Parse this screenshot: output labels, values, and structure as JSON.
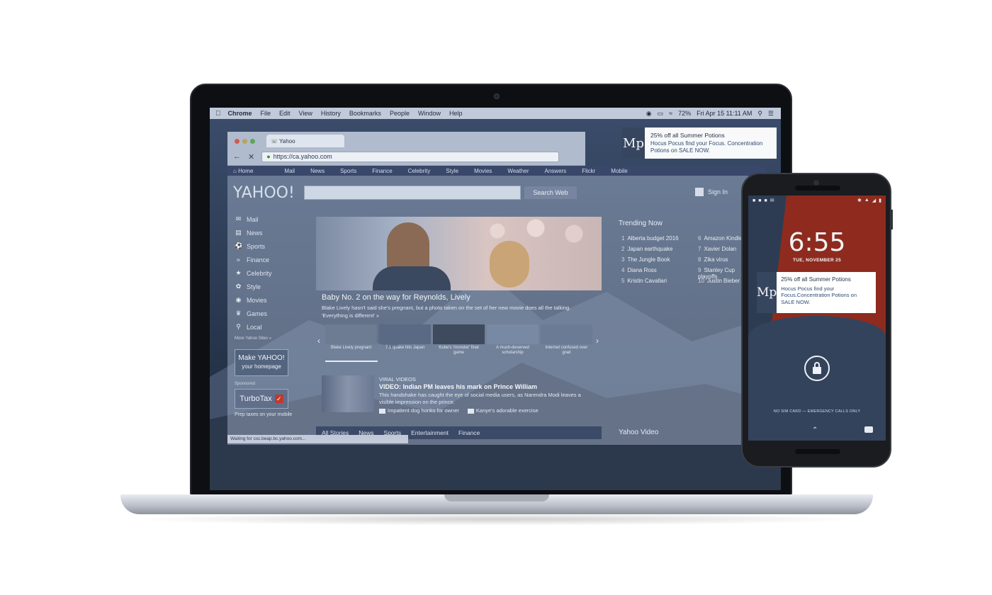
{
  "menubar": {
    "items": [
      "Chrome",
      "File",
      "Edit",
      "View",
      "History",
      "Bookmarks",
      "People",
      "Window",
      "Help"
    ],
    "battery": "72%",
    "datetime": "Fri Apr 15  11:11 AM"
  },
  "browser": {
    "tab_title": "Yahoo",
    "url": "https://ca.yahoo.com",
    "status": "Waiting for csc.beap.bc.yahoo.com..."
  },
  "yahoo": {
    "nav": [
      "Home",
      "Mail",
      "News",
      "Sports",
      "Finance",
      "Celebrity",
      "Style",
      "Movies",
      "Weather",
      "Answers",
      "Flickr",
      "Mobile"
    ],
    "logo": "YAHOO!",
    "search_button": "Search Web",
    "signin": "Sign In",
    "sidebar": [
      {
        "label": "Mail",
        "icon": "mail-icon"
      },
      {
        "label": "News",
        "icon": "news-icon"
      },
      {
        "label": "Sports",
        "icon": "sports-icon"
      },
      {
        "label": "Finance",
        "icon": "finance-icon"
      },
      {
        "label": "Celebrity",
        "icon": "star-icon"
      },
      {
        "label": "Style",
        "icon": "style-icon"
      },
      {
        "label": "Movies",
        "icon": "movies-icon"
      },
      {
        "label": "Games",
        "icon": "games-icon"
      },
      {
        "label": "Local",
        "icon": "pin-icon"
      }
    ],
    "more_sites": "More Yahoo Sites »",
    "make_home_line1": "Make YAHOO!",
    "make_home_line2": "your homepage",
    "sponsored": "Sponsored",
    "turbotax": "TurboTax",
    "prep_taxes": "Prep taxes on your mobile",
    "hero_title": "Baby No. 2 on the way for Reynolds, Lively",
    "hero_desc": "Blake Lively hasn't said she's pregnant, but a photo taken on the set of her new movie does all the talking. 'Everything is different' »",
    "thumbs": [
      "Blake Lively pregnant",
      "7.1 quake hits Japan",
      "Kobe's 'monster' final game",
      "A much-deserved scholarship",
      "Internet confused over grad"
    ],
    "viral_label": "VIRAL VIDEOS",
    "viral_title": "VIDEO: Indian PM leaves his mark on Prince William",
    "viral_desc": "This handshake has caught the eye of social media users, as Narendra Modi leaves a visible impression on the prince.",
    "viral_links": [
      "Impatient dog honks for owner",
      "Kanye's adorable exercise"
    ],
    "bottom_tabs": [
      "All Stories",
      "News",
      "Sports",
      "Entertainment",
      "Finance"
    ],
    "trending_title": "Trending Now",
    "trending_left": [
      {
        "num": "1",
        "label": "Alberta budget 2016"
      },
      {
        "num": "2",
        "label": "Japan earthquake"
      },
      {
        "num": "3",
        "label": "The Jungle Book"
      },
      {
        "num": "4",
        "label": "Diana Ross"
      },
      {
        "num": "5",
        "label": "Kristin Cavallari"
      }
    ],
    "trending_right": [
      {
        "num": "6",
        "label": "Amazon Kindle"
      },
      {
        "num": "7",
        "label": "Xavier Dolan"
      },
      {
        "num": "8",
        "label": "Zika virus"
      },
      {
        "num": "9",
        "label": "Stanley Cup playoffs"
      },
      {
        "num": "10",
        "label": "Justin Bieber"
      }
    ],
    "yahoo_video": "Yahoo Video"
  },
  "notification": {
    "logo": "Mp",
    "title": "25% off all Summer Potions",
    "body": "Hocus Pocus find your Focus. Concentration Potions on SALE NOW."
  },
  "phone": {
    "time": "6:55",
    "date": "TUE, NOVEMBER 25",
    "notif_logo": "Mp",
    "notif_title": "25% off all Summer Potions",
    "notif_body": "Hocus Pocus find your Focus.Concentration Potions on SALE NOW.",
    "sim": "NO SIM CARD — EMERGENCY CALLS ONLY"
  },
  "colors": {
    "phone_accent": "#8e2b1e",
    "phone_bg": "#34435c",
    "notif_logo_bg": "#36465f"
  }
}
